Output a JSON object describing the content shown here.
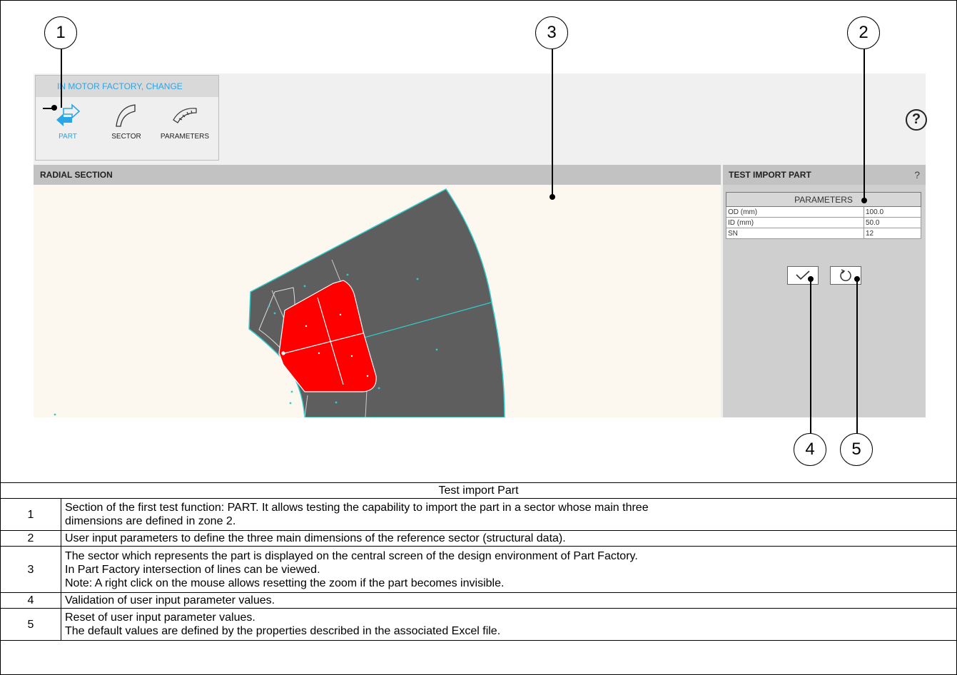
{
  "ribbon": {
    "title": "IN MOTOR FACTORY, CHANGE",
    "buttons": [
      {
        "label": "PART",
        "icon": "swap-arrows-icon",
        "active": true
      },
      {
        "label": "SECTOR",
        "icon": "sector-icon",
        "active": false
      },
      {
        "label": "PARAMETERS",
        "icon": "parameters-icon",
        "active": false
      }
    ],
    "help": "?"
  },
  "radial_section": {
    "title": "RADIAL SECTION"
  },
  "test_panel": {
    "title": "TEST IMPORT PART",
    "help": "?",
    "table_header": "PARAMETERS",
    "params": [
      {
        "name": "OD (mm)",
        "value": "100.0"
      },
      {
        "name": "ID (mm)",
        "value": "50.0"
      },
      {
        "name": "SN",
        "value": "12"
      }
    ],
    "validate_icon": "check-icon",
    "reset_icon": "reset-icon"
  },
  "callouts": [
    "1",
    "2",
    "3",
    "4",
    "5"
  ],
  "legend": {
    "caption": "Test import Part",
    "rows": [
      {
        "num": "1",
        "lines": [
          "Section of the first test function: PART. It allows testing the capability to import the part in a sector whose main three",
          "dimensions are defined in zone 2."
        ]
      },
      {
        "num": "2",
        "lines": [
          "User input parameters to define the three main dimensions of the reference sector (structural data)."
        ]
      },
      {
        "num": "3",
        "lines": [
          "The sector which represents the part is displayed on the central screen of the design environment of Part Factory.",
          "In Part Factory intersection of lines can be viewed.",
          "Note: A right click on the mouse allows resetting the zoom if the part becomes invisible."
        ]
      },
      {
        "num": "4",
        "lines": [
          "Validation of user input parameter values."
        ]
      },
      {
        "num": "5",
        "lines": [
          "Reset of user input parameter values.",
          "The default values are defined by the properties described in the associated Excel file."
        ]
      }
    ]
  },
  "colors": {
    "accent": "#2aa5e6",
    "sector": "#5e5e5e",
    "part": "#ff0000",
    "outline": "#33cccc"
  }
}
